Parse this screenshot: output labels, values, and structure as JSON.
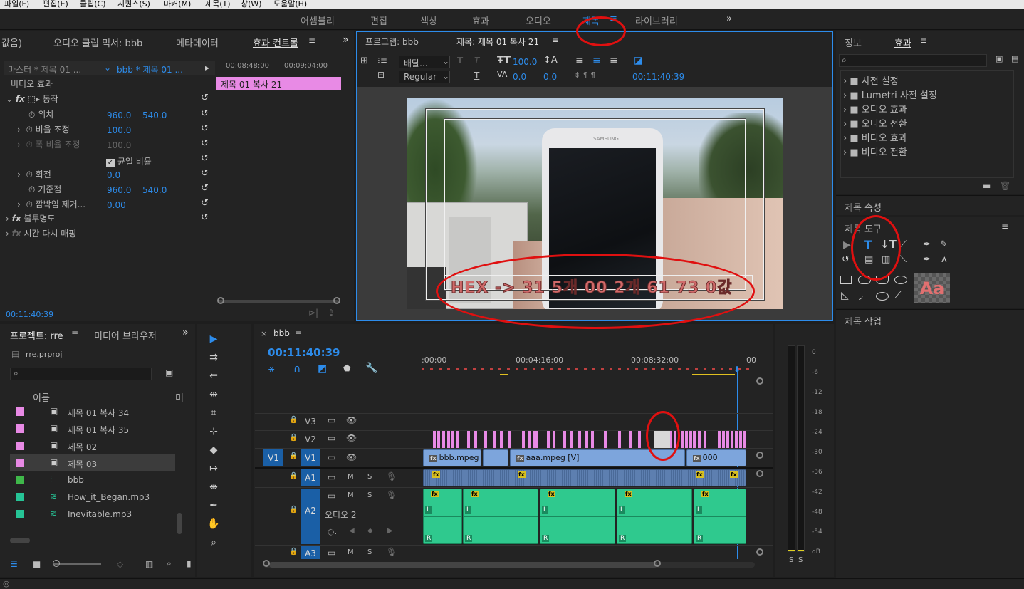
{
  "menu": [
    "파일(F)",
    "편집(E)",
    "클립(C)",
    "시퀀스(S)",
    "마커(M)",
    "제목(T)",
    "창(W)",
    "도움말(H)"
  ],
  "workspaces": [
    "어셈블리",
    "편집",
    "색상",
    "효과",
    "오디오",
    "제목",
    "라이브러리"
  ],
  "workspace_active": "제목",
  "source_panel": {
    "tabs": [
      "값음)",
      "오디오 클립 믹서: bbb",
      "메타데이터",
      "효과 컨트롤"
    ],
    "active_tab": "효과 컨트롤",
    "master_label": "마스터 * 제목 01 ...",
    "clip_label": "bbb * 제목 01 ...",
    "tc_start": "00:08:48:00",
    "tc_end": "00:09:04:00",
    "clip_name": "제목 01 복사 21",
    "video_effects": "비디오 효과",
    "motion": "동작",
    "position_label": "위치",
    "position_x": "960.0",
    "position_y": "540.0",
    "scale_label": "비율 조정",
    "scale_value": "100.0",
    "scale_width_label": "폭 비율 조정",
    "scale_width_value": "100.0",
    "uniform_scale": "균일 비율",
    "rotation_label": "회전",
    "rotation_value": "0.0",
    "anchor_label": "기준점",
    "anchor_x": "960.0",
    "anchor_y": "540.0",
    "antiflicker_label": "깜박임 제거...",
    "antiflicker_value": "0.00",
    "opacity": "불투명도",
    "time_remap": "시간 다시 매핑",
    "timecode": "00:11:40:39"
  },
  "program_panel": {
    "tab_program": "프로그램: bbb",
    "tab_title": "제목: 제목 01 복사 21",
    "font_name": "배달...",
    "font_style": "Regular",
    "font_size": "100.0",
    "tracking": "0.0",
    "kerning": "0.0",
    "timecode": "00:11:40:39",
    "overlay_text": "HEX -> 31 5개 00 2개 61 73 0값",
    "phone_brand": "SAMSUNG"
  },
  "effects_panel": {
    "tabs": [
      "정보",
      "효과"
    ],
    "active_tab": "효과",
    "items": [
      "사전 설정",
      "Lumetri 사전 설정",
      "오디오 효과",
      "오디오 전환",
      "비디오 효과",
      "비디오 전환"
    ]
  },
  "title_props": {
    "properties": "제목 속성",
    "tools": "제목 도구",
    "actions": "제목 작업",
    "sample": "Aa"
  },
  "project_panel": {
    "tabs": [
      "프로젝트: rre",
      "미디어 브라우저"
    ],
    "file": "rre.prproj",
    "column_name": "이름",
    "column_more": "미",
    "items": [
      {
        "name": "제목 01 복사 34",
        "color": "#e88ae5",
        "icon": "title-icon"
      },
      {
        "name": "제목 01 복사 35",
        "color": "#e88ae5",
        "icon": "title-icon"
      },
      {
        "name": "제목 02",
        "color": "#e88ae5",
        "icon": "title-icon"
      },
      {
        "name": "제목 03",
        "color": "#e88ae5",
        "icon": "title-icon"
      },
      {
        "name": "bbb",
        "color": "#3fb84a",
        "icon": "sequence-icon"
      },
      {
        "name": "How_it_Began.mp3",
        "color": "#26c496",
        "icon": "audio-icon"
      },
      {
        "name": "Inevitable.mp3",
        "color": "#26c496",
        "icon": "audio-icon"
      }
    ]
  },
  "timeline": {
    "tab": "bbb",
    "timecode": "00:11:40:39",
    "ruler": [
      ":00:00",
      "00:04:16:00",
      "00:08:32:00",
      "00"
    ],
    "tracks_video": [
      "V3",
      "V2",
      "V1"
    ],
    "tracks_audio": [
      "A1",
      "A2",
      "A3"
    ],
    "source_v1": "V1",
    "audio2_name": "오디오 2",
    "mute": "M",
    "solo": "S",
    "clip_bbb": "bbb.mpeg",
    "clip_aaa": "aaa.mpeg [V]",
    "clip_000": "000",
    "fx": "fx",
    "ch_l": "L",
    "ch_r": "R"
  },
  "audio_meter": {
    "scale": [
      "0",
      "-6",
      "-12",
      "-18",
      "-24",
      "-30",
      "-36",
      "-42",
      "-48",
      "-54",
      "dB"
    ],
    "solo": [
      "S",
      "S"
    ]
  }
}
